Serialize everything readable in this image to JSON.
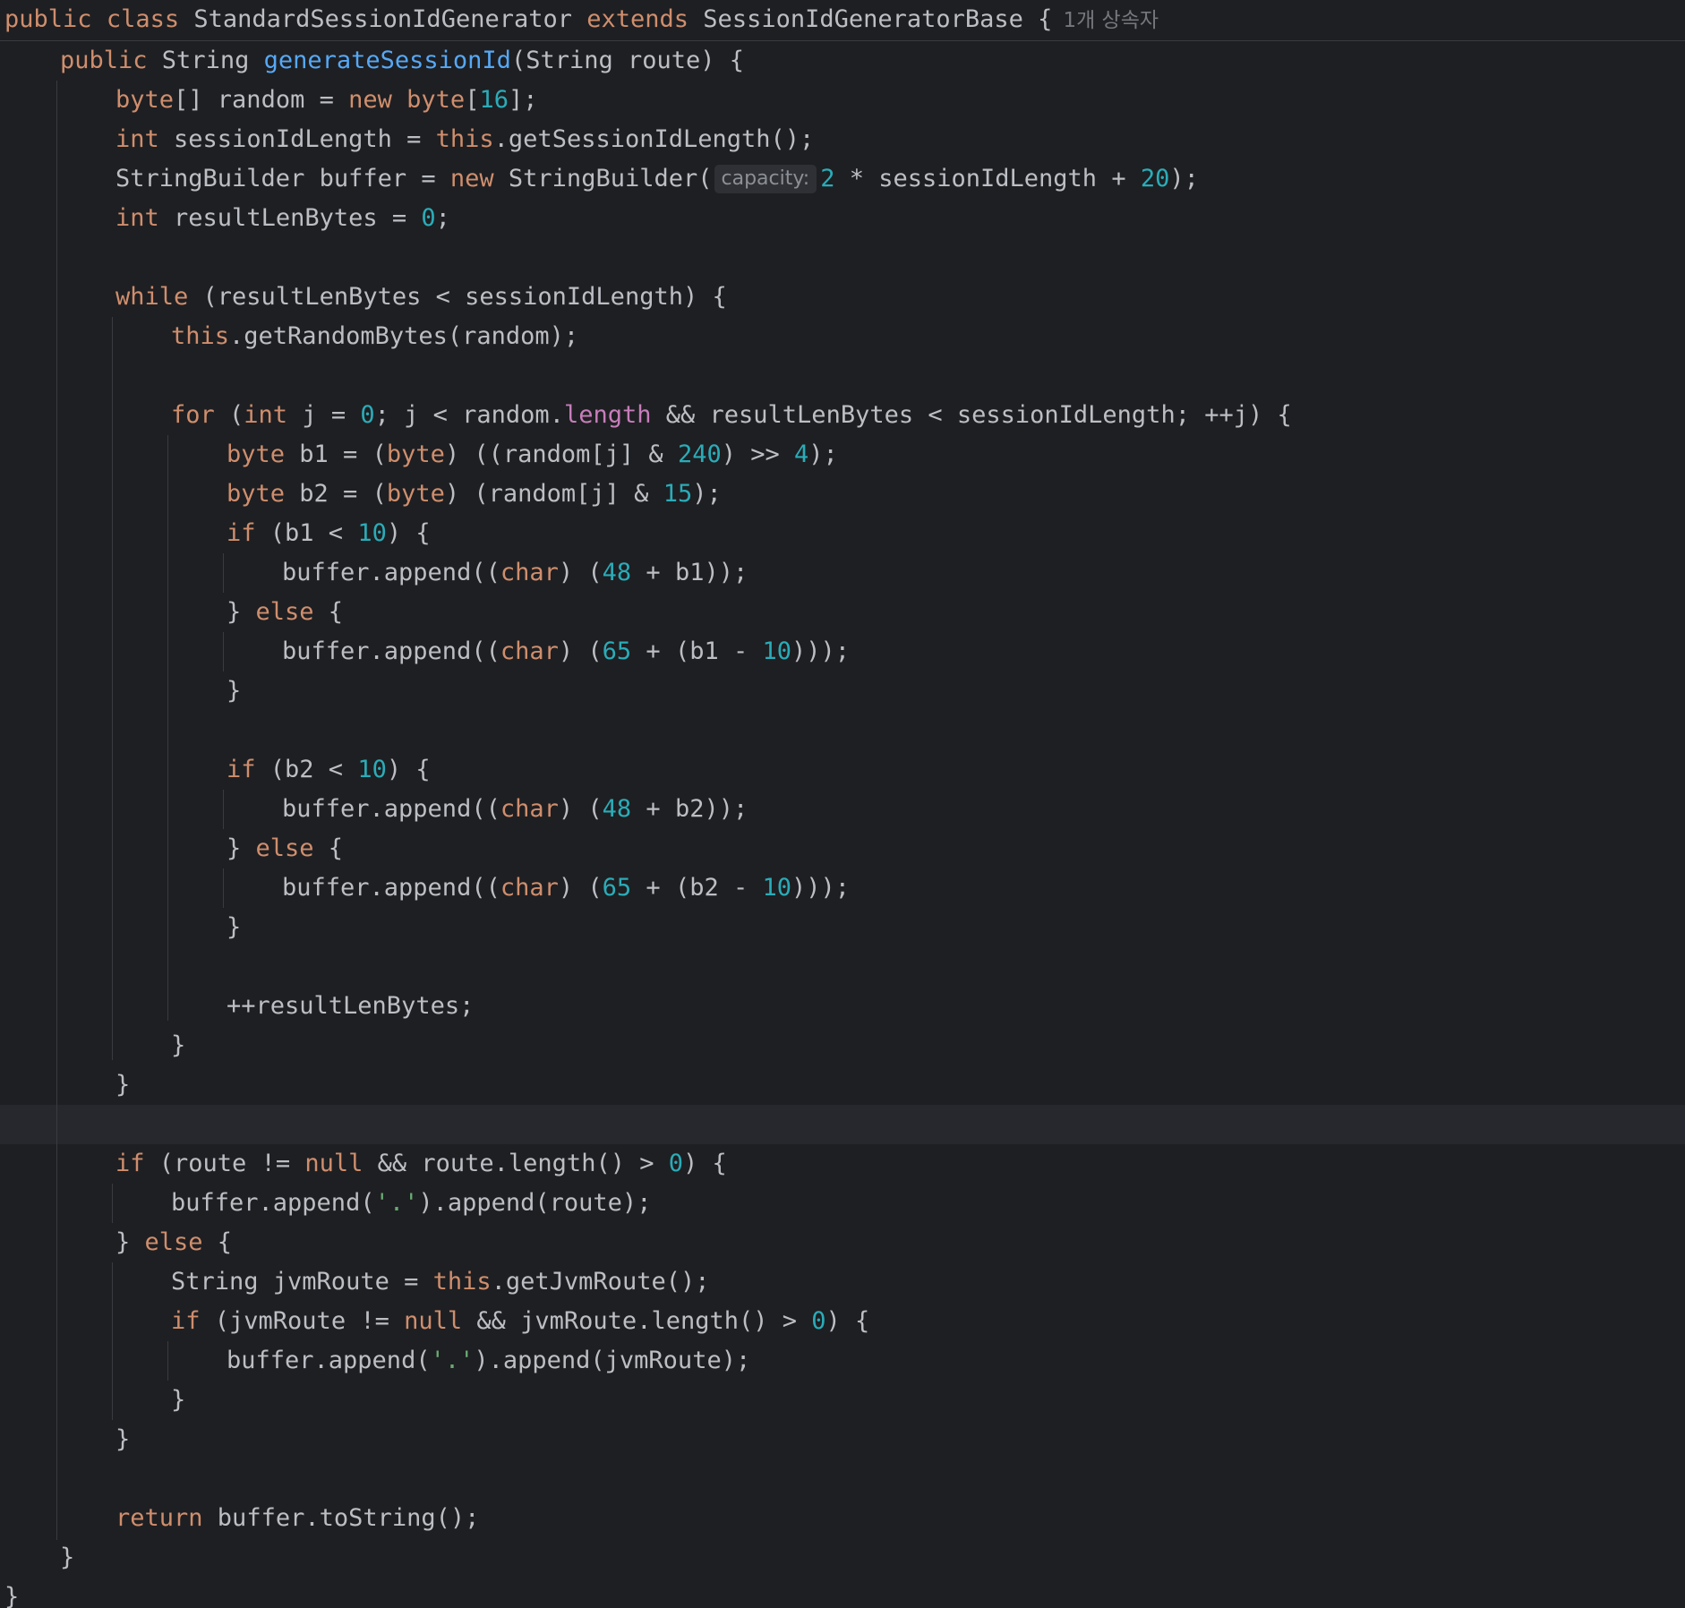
{
  "code": {
    "l01": {
      "a": "public",
      "b": " ",
      "c": "class",
      "d": " StandardSessionIdGenerator ",
      "e": "extends",
      "f": " SessionIdGeneratorBase {"
    },
    "inherit_hint": "1개 상속자",
    "l02": {
      "a": "public",
      "b": " String ",
      "c": "generateSessionId",
      "d": "(String route) {"
    },
    "l03": {
      "a": "byte",
      "b": "[] random = ",
      "c": "new",
      "d": " ",
      "e": "byte",
      "f": "[",
      "g": "16",
      "h": "];"
    },
    "l04": {
      "a": "int",
      "b": " sessionIdLength = ",
      "c": "this",
      "d": ".getSessionIdLength();"
    },
    "l05": {
      "a": "StringBuilder buffer = ",
      "b": "new",
      "c": " StringBuilder(",
      "hint": "capacity:",
      "d": "2",
      "e": " * sessionIdLength + ",
      "f": "20",
      "g": ");"
    },
    "l06": {
      "a": "int",
      "b": " resultLenBytes = ",
      "c": "0",
      "d": ";"
    },
    "l08": {
      "a": "while",
      "b": " (resultLenBytes < sessionIdLength) {"
    },
    "l09": {
      "a": "this",
      "b": ".getRandomBytes(random);"
    },
    "l11": {
      "a": "for",
      "b": " (",
      "c": "int",
      "d": " j = ",
      "e": "0",
      "f": "; j < random.",
      "g": "length",
      "h": " && resultLenBytes < sessionIdLength; ++j) {"
    },
    "l12": {
      "a": "byte",
      "b": " b1 = (",
      "c": "byte",
      "d": ") ((random[j] & ",
      "e": "240",
      "f": ") >> ",
      "g": "4",
      "h": ");"
    },
    "l13": {
      "a": "byte",
      "b": " b2 = (",
      "c": "byte",
      "d": ") (random[j] & ",
      "e": "15",
      "f": ");"
    },
    "l14": {
      "a": "if",
      "b": " (b1 < ",
      "c": "10",
      "d": ") {"
    },
    "l15": {
      "a": "buffer.append((",
      "b": "char",
      "c": ") (",
      "d": "48",
      "e": " + b1));"
    },
    "l16": {
      "a": "} ",
      "b": "else",
      "c": " {"
    },
    "l17": {
      "a": "buffer.append((",
      "b": "char",
      "c": ") (",
      "d": "65",
      "e": " + (b1 - ",
      "f": "10",
      "g": ")));"
    },
    "l18": "}",
    "l20": {
      "a": "if",
      "b": " (b2 < ",
      "c": "10",
      "d": ") {"
    },
    "l21": {
      "a": "buffer.append((",
      "b": "char",
      "c": ") (",
      "d": "48",
      "e": " + b2));"
    },
    "l22": {
      "a": "} ",
      "b": "else",
      "c": " {"
    },
    "l23": {
      "a": "buffer.append((",
      "b": "char",
      "c": ") (",
      "d": "65",
      "e": " + (b2 - ",
      "f": "10",
      "g": ")));"
    },
    "l24": "}",
    "l26": "++resultLenBytes;",
    "l27": "}",
    "l28": "}",
    "l30": {
      "a": "if",
      "b": " (route != ",
      "c": "null",
      "d": " && route.length() > ",
      "e": "0",
      "f": ") {"
    },
    "l31": {
      "a": "buffer.append(",
      "b": "'.'",
      "c": ").append(route);"
    },
    "l32": {
      "a": "} ",
      "b": "else",
      "c": " {"
    },
    "l33": {
      "a": "String jvmRoute = ",
      "b": "this",
      "c": ".getJvmRoute();"
    },
    "l34": {
      "a": "if",
      "b": " (jvmRoute != ",
      "c": "null",
      "d": " && jvmRoute.length() > ",
      "e": "0",
      "f": ") {"
    },
    "l35": {
      "a": "buffer.append(",
      "b": "'.'",
      "c": ").append(jvmRoute);"
    },
    "l36": "}",
    "l37": "}",
    "l39": {
      "a": "return",
      "b": " buffer.toString();"
    },
    "l40": "}",
    "l41": "}"
  },
  "colors": {
    "background": "#1e1f22",
    "text": "#bcbec4",
    "keyword": "#cf8e6d",
    "method_declaration": "#56a8f5",
    "number": "#2aacb8",
    "string": "#6aab73",
    "field": "#c77dbb",
    "caret_row": "#26282e",
    "indent_guide": "#393b40"
  }
}
